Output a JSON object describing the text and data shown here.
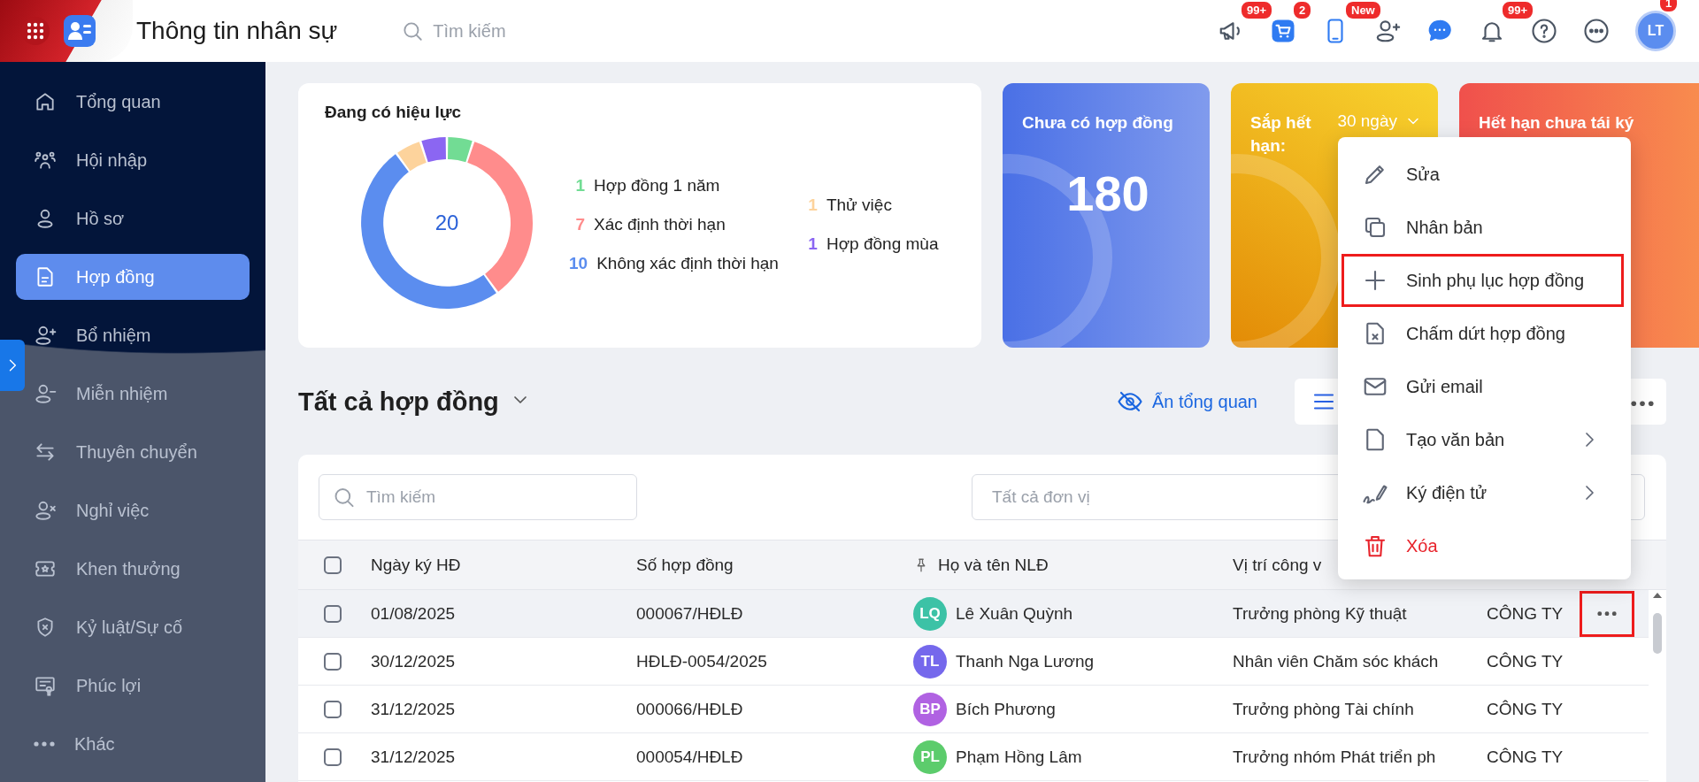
{
  "header": {
    "title": "Thông tin nhân sự",
    "search_placeholder": "Tìm kiếm",
    "toolbar": [
      {
        "kind": "badged",
        "badge": "99+"
      },
      {
        "kind": "badged",
        "badge": "2"
      },
      {
        "kind": "badged",
        "badge": "New"
      },
      {
        "kind": "plain"
      },
      {
        "kind": "plain"
      },
      {
        "kind": "badged",
        "badge": "99+"
      },
      {
        "kind": "plain"
      },
      {
        "kind": "plain"
      }
    ],
    "avatar": {
      "initials": "LT",
      "badge": "1"
    }
  },
  "sidebar": {
    "items": [
      {
        "label": "Tổng quan",
        "selected": false
      },
      {
        "label": "Hội nhập",
        "selected": false
      },
      {
        "label": "Hồ sơ",
        "selected": false
      },
      {
        "label": "Hợp đồng",
        "selected": true
      },
      {
        "label": "Bổ nhiệm",
        "selected": false
      },
      {
        "label": "Miễn nhiệm",
        "selected": false
      },
      {
        "label": "Thuyên chuyển",
        "selected": false
      },
      {
        "label": "Nghỉ việc",
        "selected": false
      },
      {
        "label": "Khen thưởng",
        "selected": false
      },
      {
        "label": "Kỷ luật/Sự cố",
        "selected": false
      },
      {
        "label": "Phúc lợi",
        "selected": false
      },
      {
        "label": "Khác",
        "selected": false
      }
    ]
  },
  "summary": {
    "total": "20",
    "legend": [
      {
        "count": "1",
        "color": "#72dc94"
      },
      {
        "count": "7",
        "color": "#ff8c8c"
      },
      {
        "count": "10",
        "color": "#5b8def"
      },
      {
        "count": "1",
        "color": "#fdd39c"
      },
      {
        "count": "1",
        "color": "#8b66f2"
      }
    ],
    "chart_data": {
      "type": "donut",
      "categories": [
        "Hợp đồng 1 năm",
        "Xác định thời hạn",
        "Không xác định thời hạn",
        "Thử việc",
        "Hợp đồng mùa"
      ],
      "series": [
        {
          "name": "Đang có hiệu lực",
          "values": [
            1,
            7,
            10,
            1,
            1
          ]
        }
      ]
    }
  },
  "stat_cards": [
    {
      "kind": "plain",
      "title": "Chưa có hợp đồng",
      "value": "180",
      "color": "#4a70e6"
    },
    {
      "kind": "period",
      "title": "Sắp hết hạn:",
      "period": "30 ngày",
      "color": "#e38b06"
    },
    {
      "kind": "plain",
      "title": "Hết hạn chưa tái ký",
      "color": "#f0504c"
    }
  ],
  "list": {
    "title": "Tất cả hợp đồng",
    "toggle_overview": "Ẩn tổng quan",
    "search_placeholder": "Tìm kiếm",
    "unit_placeholder": "Tất cả đơn vị",
    "all_checked": false,
    "columns": [
      {
        "label": "Ngày ký HĐ",
        "pinned": false
      },
      {
        "label": "Số hợp đồng",
        "pinned": false
      },
      {
        "label": "Họ và tên NLĐ",
        "pinned": true
      },
      {
        "label": "Vị trí công v",
        "pinned": false
      }
    ],
    "rows": [
      {
        "checked": false,
        "active": true,
        "annotated": true,
        "date": "01/08/2025",
        "number": "000067/HĐLĐ",
        "initials": "LQ",
        "color": "#3cc2a6",
        "name": "Lê Xuân Quỳnh",
        "position": "Trưởng phòng Kỹ thuật",
        "column_5": "CÔNG TY"
      },
      {
        "checked": false,
        "active": false,
        "date": "30/12/2025",
        "number": "HĐLĐ-0054/2025",
        "initials": "TL",
        "color": "#7568ec",
        "name": "Thanh Nga Lương",
        "position": "Nhân viên Chăm sóc khách",
        "column_5": "CÔNG TY"
      },
      {
        "checked": false,
        "active": false,
        "date": "31/12/2025",
        "number": "000066/HĐLĐ",
        "initials": "BP",
        "color": "#b062e2",
        "name": "Bích Phương",
        "position": "Trưởng phòng Tài chính",
        "column_5": "CÔNG TY"
      },
      {
        "checked": false,
        "active": false,
        "date": "31/12/2025",
        "number": "000054/HĐLĐ",
        "initials": "PL",
        "color": "#5ccc6c",
        "name": "Phạm Hồng Lâm",
        "position": "Trưởng nhóm Phát triển ph",
        "column_5": "CÔNG TY"
      }
    ]
  },
  "context_menu": {
    "items": [
      {
        "label": "Sửa",
        "submenu": false,
        "danger": false,
        "annotated": false
      },
      {
        "label": "Nhân bản",
        "submenu": false,
        "danger": false,
        "annotated": false
      },
      {
        "label": "Sinh phụ lục hợp đồng",
        "submenu": false,
        "danger": false,
        "annotated": true
      },
      {
        "label": "Chấm dứt hợp đồng",
        "submenu": false,
        "danger": false,
        "annotated": false
      },
      {
        "label": "Gửi email",
        "submenu": false,
        "danger": false,
        "annotated": false
      },
      {
        "label": "Tạo văn bản",
        "submenu": true,
        "danger": false,
        "annotated": false
      },
      {
        "label": "Ký điện tử",
        "submenu": true,
        "danger": false,
        "annotated": false
      },
      {
        "label": "Xóa",
        "submenu": false,
        "danger": true,
        "annotated": false
      }
    ]
  }
}
